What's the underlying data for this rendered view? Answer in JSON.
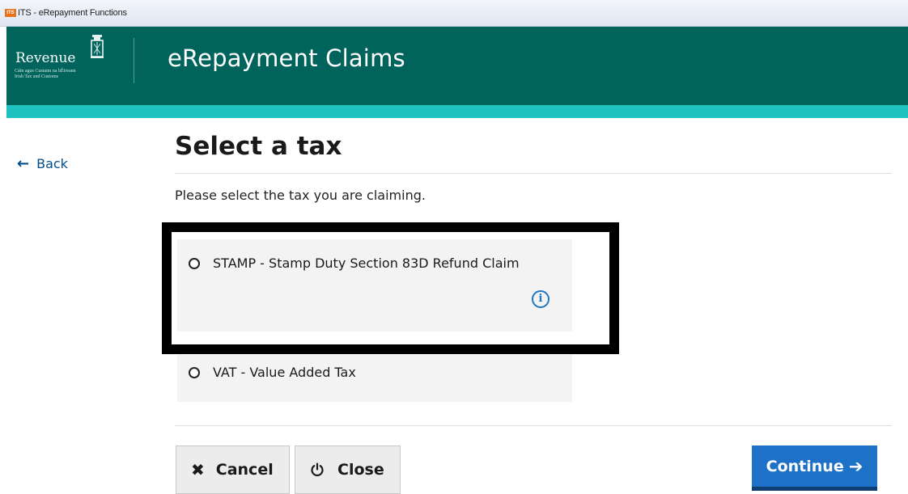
{
  "window": {
    "title": "ITS - eRepayment Functions",
    "app_icon_text": "ITS"
  },
  "header": {
    "logo_text": "Revenue",
    "logo_subtitle_line1": "Cáin agus Custaim na hÉireann",
    "logo_subtitle_line2": "Irish Tax and Customs",
    "title": "eRepayment Claims",
    "colors": {
      "header_bg": "#00645c",
      "strip": "#1ec2c0"
    }
  },
  "nav": {
    "back_label": "Back"
  },
  "main": {
    "page_title": "Select a tax",
    "instruction": "Please select the tax you are claiming.",
    "options": [
      {
        "label": "STAMP - Stamp Duty Section 83D Refund Claim",
        "selected": false,
        "info_icon": "info-icon"
      },
      {
        "label": "VAT - Value Added Tax",
        "selected": false
      }
    ]
  },
  "buttons": {
    "cancel_label": "Cancel",
    "close_label": "Close",
    "continue_label": "Continue",
    "continue_color": "#1d71c7"
  }
}
